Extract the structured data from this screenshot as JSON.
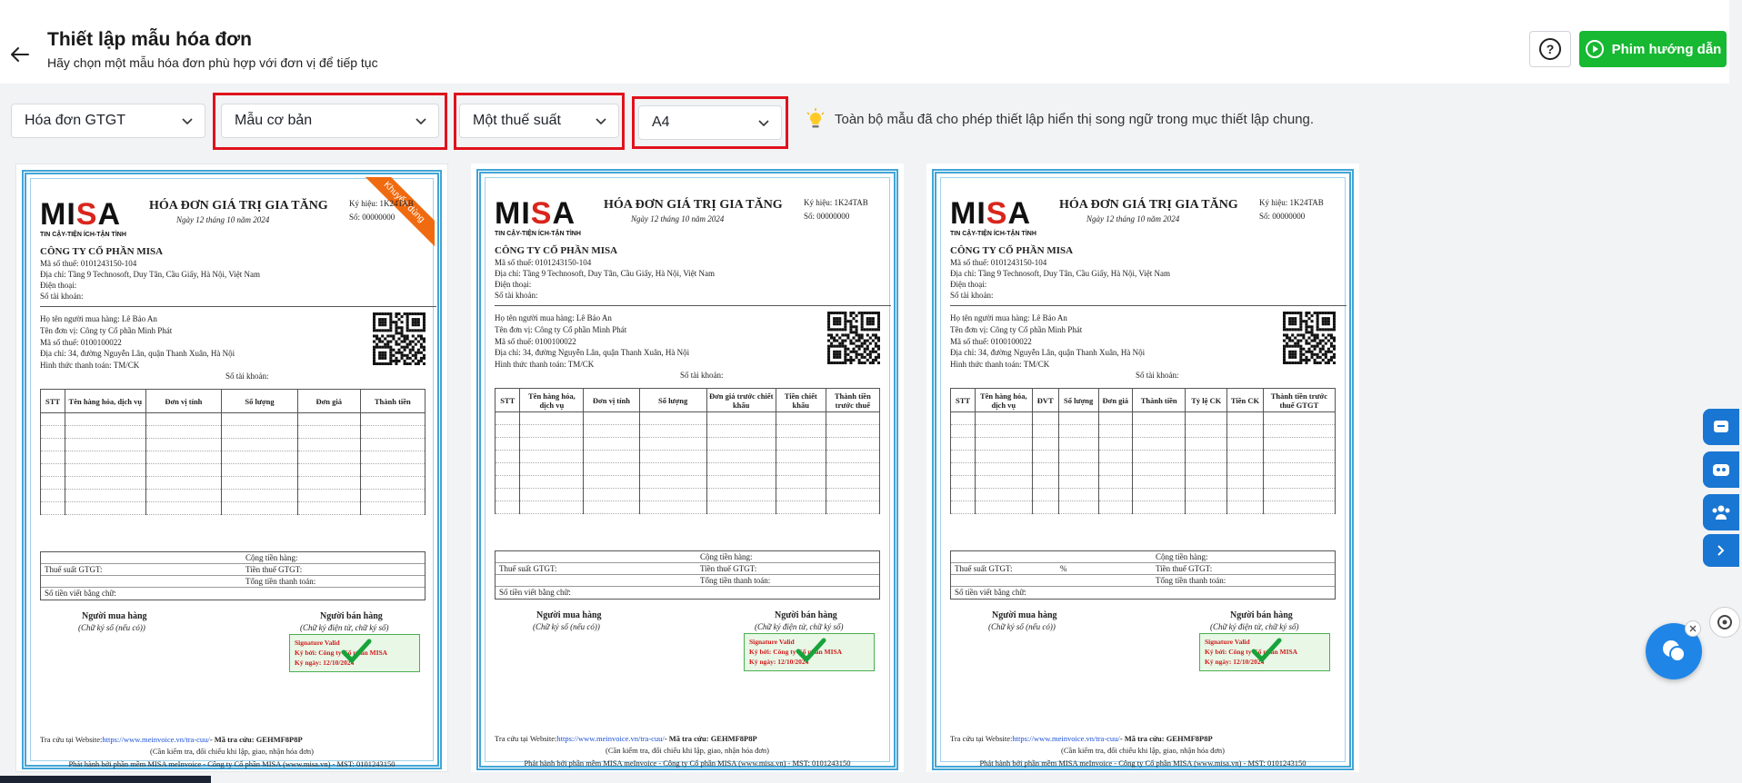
{
  "header": {
    "title": "Thiết lập mẫu hóa đơn",
    "subtitle": "Hãy chọn một mẫu hóa đơn phù hợp với đơn vị để tiếp tục",
    "help_label": "?",
    "guide_label": "Phim hướng dẫn"
  },
  "filters": {
    "invoice_type": "Hóa đơn GTGT",
    "template_style": "Mẫu cơ bản",
    "tax_rate": "Một thuế suất",
    "paper_size": "A4",
    "note": "Toàn bộ mẫu đã cho phép thiết lập hiển thị song ngữ trong mục thiết lập chung."
  },
  "colors": {
    "accent_green": "#17b832",
    "highlight_red": "#e0121c",
    "frame_blue": "#42a5d6",
    "ribbon_orange": "#f06a0f"
  },
  "invoice_common": {
    "logo_text_1": "MI",
    "logo_text_2": "S",
    "logo_text_3": "A",
    "logo_tag": "TIN CẬY-TIỆN ÍCH-TẬN TÌNH",
    "title": "HÓA ĐƠN GIÁ TRỊ GIA TĂNG",
    "date": "Ngày 12 tháng 10 năm 2024",
    "serial": "Ký hiệu: 1K24TAB",
    "number": "Số: 00000000",
    "seller_company": "CÔNG TY CỔ PHẦN MISA",
    "seller_tax": "Mã số thuế: 0101243150-104",
    "seller_address": "Địa chỉ: Tầng 9 Technosoft, Duy Tân, Cầu Giấy, Hà Nội, Việt Nam",
    "seller_phone": "Điện thoại:",
    "seller_account": "Số tài khoản:",
    "buyer_name": "Họ tên người mua hàng: Lê Bảo An",
    "buyer_unit": "Tên đơn vị: Công ty Cổ phần Minh Phát",
    "buyer_tax": "Mã số thuế: 0100100022",
    "buyer_address": "Địa chỉ: 34, đường Nguyễn Lân, quận Thanh Xuân, Hà Nội",
    "payment_method": "Hình thức thanh toán: TM/CK",
    "buyer_account": "Số tài khoản:",
    "total_goods": "Cộng tiền hàng:",
    "vat_rate": "Thuế suất GTGT:",
    "vat_amount": "Tiền thuế GTGT:",
    "grand_total": "Tổng tiền thanh toán:",
    "amount_words": "Số tiền viết bằng chữ:",
    "buyer_sign": "Người mua hàng",
    "buyer_sign_note": "(Chữ ký số (nếu có))",
    "seller_sign": "Người bán hàng",
    "seller_sign_note": "(Chữ ký điện tử, chữ ký số)",
    "sig_valid": "Signature Valid",
    "sig_by": "Ký bởi: Công ty Cổ phần MISA",
    "sig_date": "Ký ngày: 12/10/2024",
    "lookup_prefix": "Tra cứu tại Website:",
    "lookup_link": "https://www.meinvoice.vn/tra-cuu/",
    "lookup_code": "- Mã tra cứu: GEHMF8P8P",
    "lookup_note": "(Cần kiểm tra, đối chiếu khi lập, giao, nhận hóa đơn)",
    "publisher": "Phát hành bởi phần mềm MISA meInvoice - Công ty Cổ phần MISA (www.misa.vn) - MST: 0101243150"
  },
  "templates": [
    {
      "ribbon": "Khuyến dùng",
      "columns": [
        "STT",
        "Tên hàng hóa, dịch vụ",
        "Đơn vị tính",
        "Số lượng",
        "Đơn giá",
        "Thành tiền"
      ],
      "vat_percent": ""
    },
    {
      "ribbon": "",
      "columns": [
        "STT",
        "Tên hàng hóa, dịch vụ",
        "Đơn vị tính",
        "Số lượng",
        "Đơn giá trước chiết khấu",
        "Tiền chiết khấu",
        "Thành tiền trước thuế"
      ],
      "vat_percent": ""
    },
    {
      "ribbon": "",
      "columns": [
        "STT",
        "Tên hàng hóa, dịch vụ",
        "ĐVT",
        "Số lượng",
        "Đơn giá",
        "Thành tiền",
        "Tỷ lệ CK",
        "Tiền CK",
        "Thành tiền trước thuế GTGT"
      ],
      "vat_percent": "%"
    }
  ]
}
